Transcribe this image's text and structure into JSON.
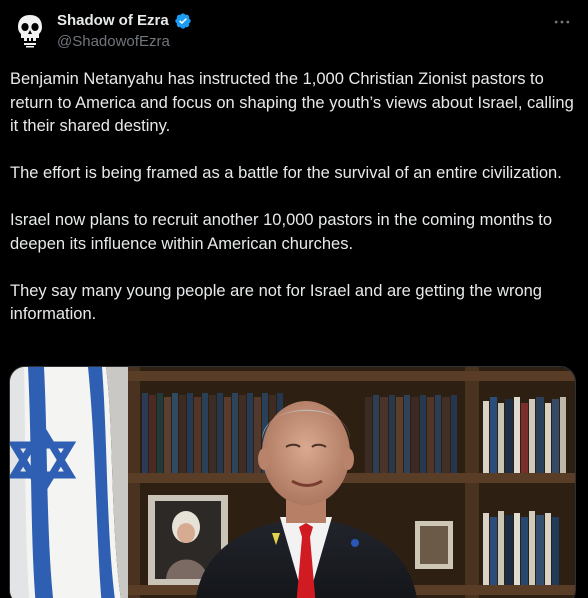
{
  "author": {
    "display_name": "Shadow of Ezra",
    "handle": "@ShadowofEzra",
    "verified": true,
    "avatar_icon": "skull-logo-icon"
  },
  "menu_icon": "more-options-icon",
  "tweet": {
    "paragraphs": [
      "Benjamin Netanyahu has instructed the 1,000 Christian Zionist pastors to return to America and focus on shaping the youth’s views about Israel, calling it their shared destiny.",
      "The effort is being framed as a battle for the survival of an entire civilization.",
      "Israel now plans to recruit another 10,000 pastors in the coming months to deepen its influence within American churches.",
      "They say many young people are not for Israel and are getting the wrong information."
    ]
  },
  "colors": {
    "background": "#000000",
    "text": "#e7e9ea",
    "secondary": "#71767b",
    "verified": "#1d9bf0"
  }
}
